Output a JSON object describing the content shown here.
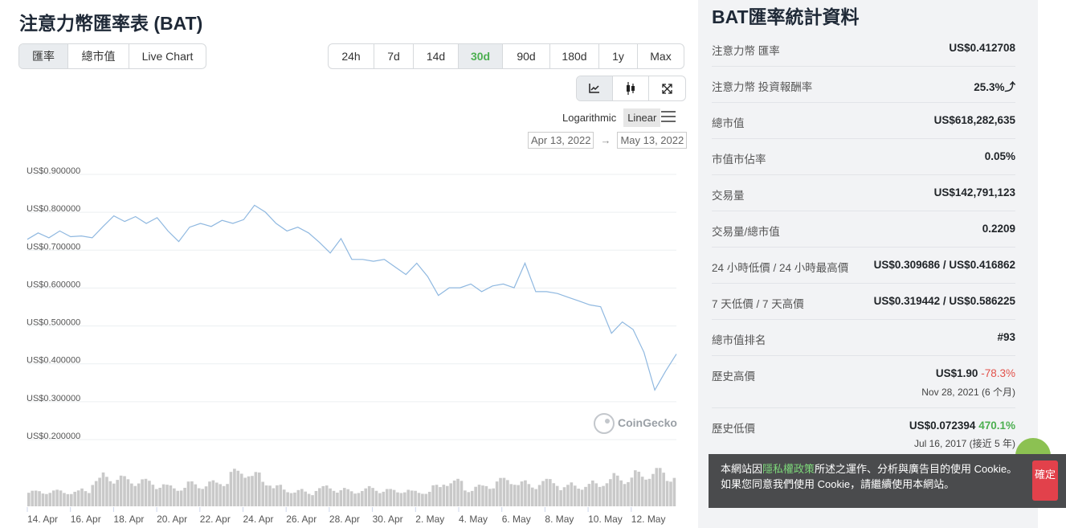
{
  "page": {
    "title": "注意力幣匯率表 (BAT)"
  },
  "left_tabs": [
    {
      "label": "匯率",
      "active": true
    },
    {
      "label": "總市值",
      "active": false
    },
    {
      "label": "Live Chart",
      "active": false
    }
  ],
  "range_tabs": [
    {
      "label": "24h",
      "active": false
    },
    {
      "label": "7d",
      "active": false
    },
    {
      "label": "14d",
      "active": false
    },
    {
      "label": "30d",
      "active": true
    },
    {
      "label": "90d",
      "active": false
    },
    {
      "label": "180d",
      "active": false
    },
    {
      "label": "1y",
      "active": false
    },
    {
      "label": "Max",
      "active": false
    }
  ],
  "tools": [
    {
      "icon": "line-chart-icon",
      "active": true
    },
    {
      "icon": "candlestick-icon",
      "active": false
    },
    {
      "icon": "fullscreen-icon",
      "active": false
    }
  ],
  "scale": {
    "logarithmic": "Logarithmic",
    "linear": "Linear",
    "selected": "Linear"
  },
  "date_range": {
    "from": "Apr 13, 2022",
    "arrow": "→",
    "to": "May 13, 2022"
  },
  "chart_data": {
    "type": "line",
    "y_ticks": [
      "US$0.900000",
      "US$0.800000",
      "US$0.700000",
      "US$0.600000",
      "US$0.500000",
      "US$0.400000",
      "US$0.300000",
      "US$0.200000"
    ],
    "ylim": [
      0.2,
      0.9
    ],
    "x_ticks": [
      "14. Apr",
      "16. Apr",
      "18. Apr",
      "20. Apr",
      "22. Apr",
      "24. Apr",
      "26. Apr",
      "28. Apr",
      "30. Apr",
      "2. May",
      "4. May",
      "6. May",
      "8. May",
      "10. May",
      "12. May"
    ],
    "series": [
      {
        "x": [
          0,
          0.5,
          1,
          1.5,
          2,
          2.5,
          3,
          3.5,
          4,
          4.5,
          5,
          5.5,
          6,
          6.5,
          7,
          7.5,
          8,
          8.5,
          9,
          9.5,
          10,
          10.5,
          11,
          11.5,
          12,
          12.5,
          13,
          13.5,
          14,
          14.5,
          15,
          15.5,
          16,
          16.5,
          17,
          17.5,
          18,
          18.5,
          19,
          19.5,
          20,
          20.5,
          21,
          21.5,
          22,
          22.5,
          23,
          23.5,
          24,
          24.5,
          25,
          25.5,
          26,
          26.5,
          27,
          27.5,
          28,
          28.5,
          29,
          29.5,
          30
        ],
        "values": [
          0.718,
          0.735,
          0.722,
          0.74,
          0.725,
          0.727,
          0.722,
          0.752,
          0.78,
          0.765,
          0.778,
          0.76,
          0.775,
          0.74,
          0.712,
          0.75,
          0.76,
          0.752,
          0.768,
          0.76,
          0.77,
          0.808,
          0.79,
          0.76,
          0.74,
          0.75,
          0.735,
          0.71,
          0.682,
          0.72,
          0.665,
          0.665,
          0.66,
          0.665,
          0.645,
          0.625,
          0.655,
          0.62,
          0.57,
          0.59,
          0.59,
          0.6,
          0.58,
          0.595,
          0.6,
          0.59,
          0.655,
          0.58,
          0.58,
          0.575,
          0.565,
          0.555,
          0.545,
          0.54,
          0.47,
          0.5,
          0.48,
          0.42,
          0.32,
          0.37,
          0.415
        ]
      }
    ],
    "volume": [
      22,
      24,
      23,
      24,
      22,
      26,
      40,
      48,
      44,
      42,
      40,
      38,
      34,
      30,
      30,
      35,
      34,
      36,
      40,
      52,
      56,
      48,
      40,
      30,
      26,
      24,
      22,
      28,
      30,
      26,
      24,
      26,
      28,
      26,
      24,
      26,
      22,
      24,
      30,
      40,
      38,
      28,
      30,
      34,
      40,
      42,
      36,
      34,
      38,
      40,
      30,
      34,
      32,
      36,
      40,
      46,
      44,
      50,
      52,
      54,
      48
    ],
    "watermark": "CoinGecko"
  },
  "stats": {
    "title": "BAT匯率統計資料",
    "rows": [
      {
        "label": "注意力幣 匯率",
        "value": "US$0.412708"
      },
      {
        "label": "注意力幣 投資報酬率",
        "value": "25.3%⤴"
      },
      {
        "label": "總市值",
        "value": "US$618,282,635"
      },
      {
        "label": "市值市佔率",
        "value": "0.05%"
      },
      {
        "label": "交易量",
        "value": "US$142,791,123"
      },
      {
        "label": "交易量/總市值",
        "value": "0.2209"
      },
      {
        "label": "24 小時低價 / 24 小時最高價",
        "value": "US$0.309686 / US$0.416862"
      },
      {
        "label": "7 天低價 / 7 天高價",
        "value": "US$0.319442 / US$0.586225"
      },
      {
        "label": "總市值排名",
        "value": "#93"
      },
      {
        "label": "歷史高價",
        "value": "US$1.90",
        "change": "-78.3%",
        "sub": "Nov 28, 2021 (6 个月)"
      },
      {
        "label": "歷史低價",
        "value": "US$0.072394",
        "change": "470.1%",
        "sub": "Jul 16, 2017 (接近 5 年)"
      }
    ]
  },
  "cookie": {
    "pre": "本網站因",
    "link": "隱私權政策",
    "post": "所述之運作、分析與廣告目的使用 Cookie。如果您同意我們使用 Cookie，請繼續使用本網站。",
    "button": "確定"
  },
  "colors": {
    "line": "#8fb8e0",
    "accent_green": "#4caf50",
    "accent_red": "#e2524b",
    "volume": "#c9c9c9"
  }
}
